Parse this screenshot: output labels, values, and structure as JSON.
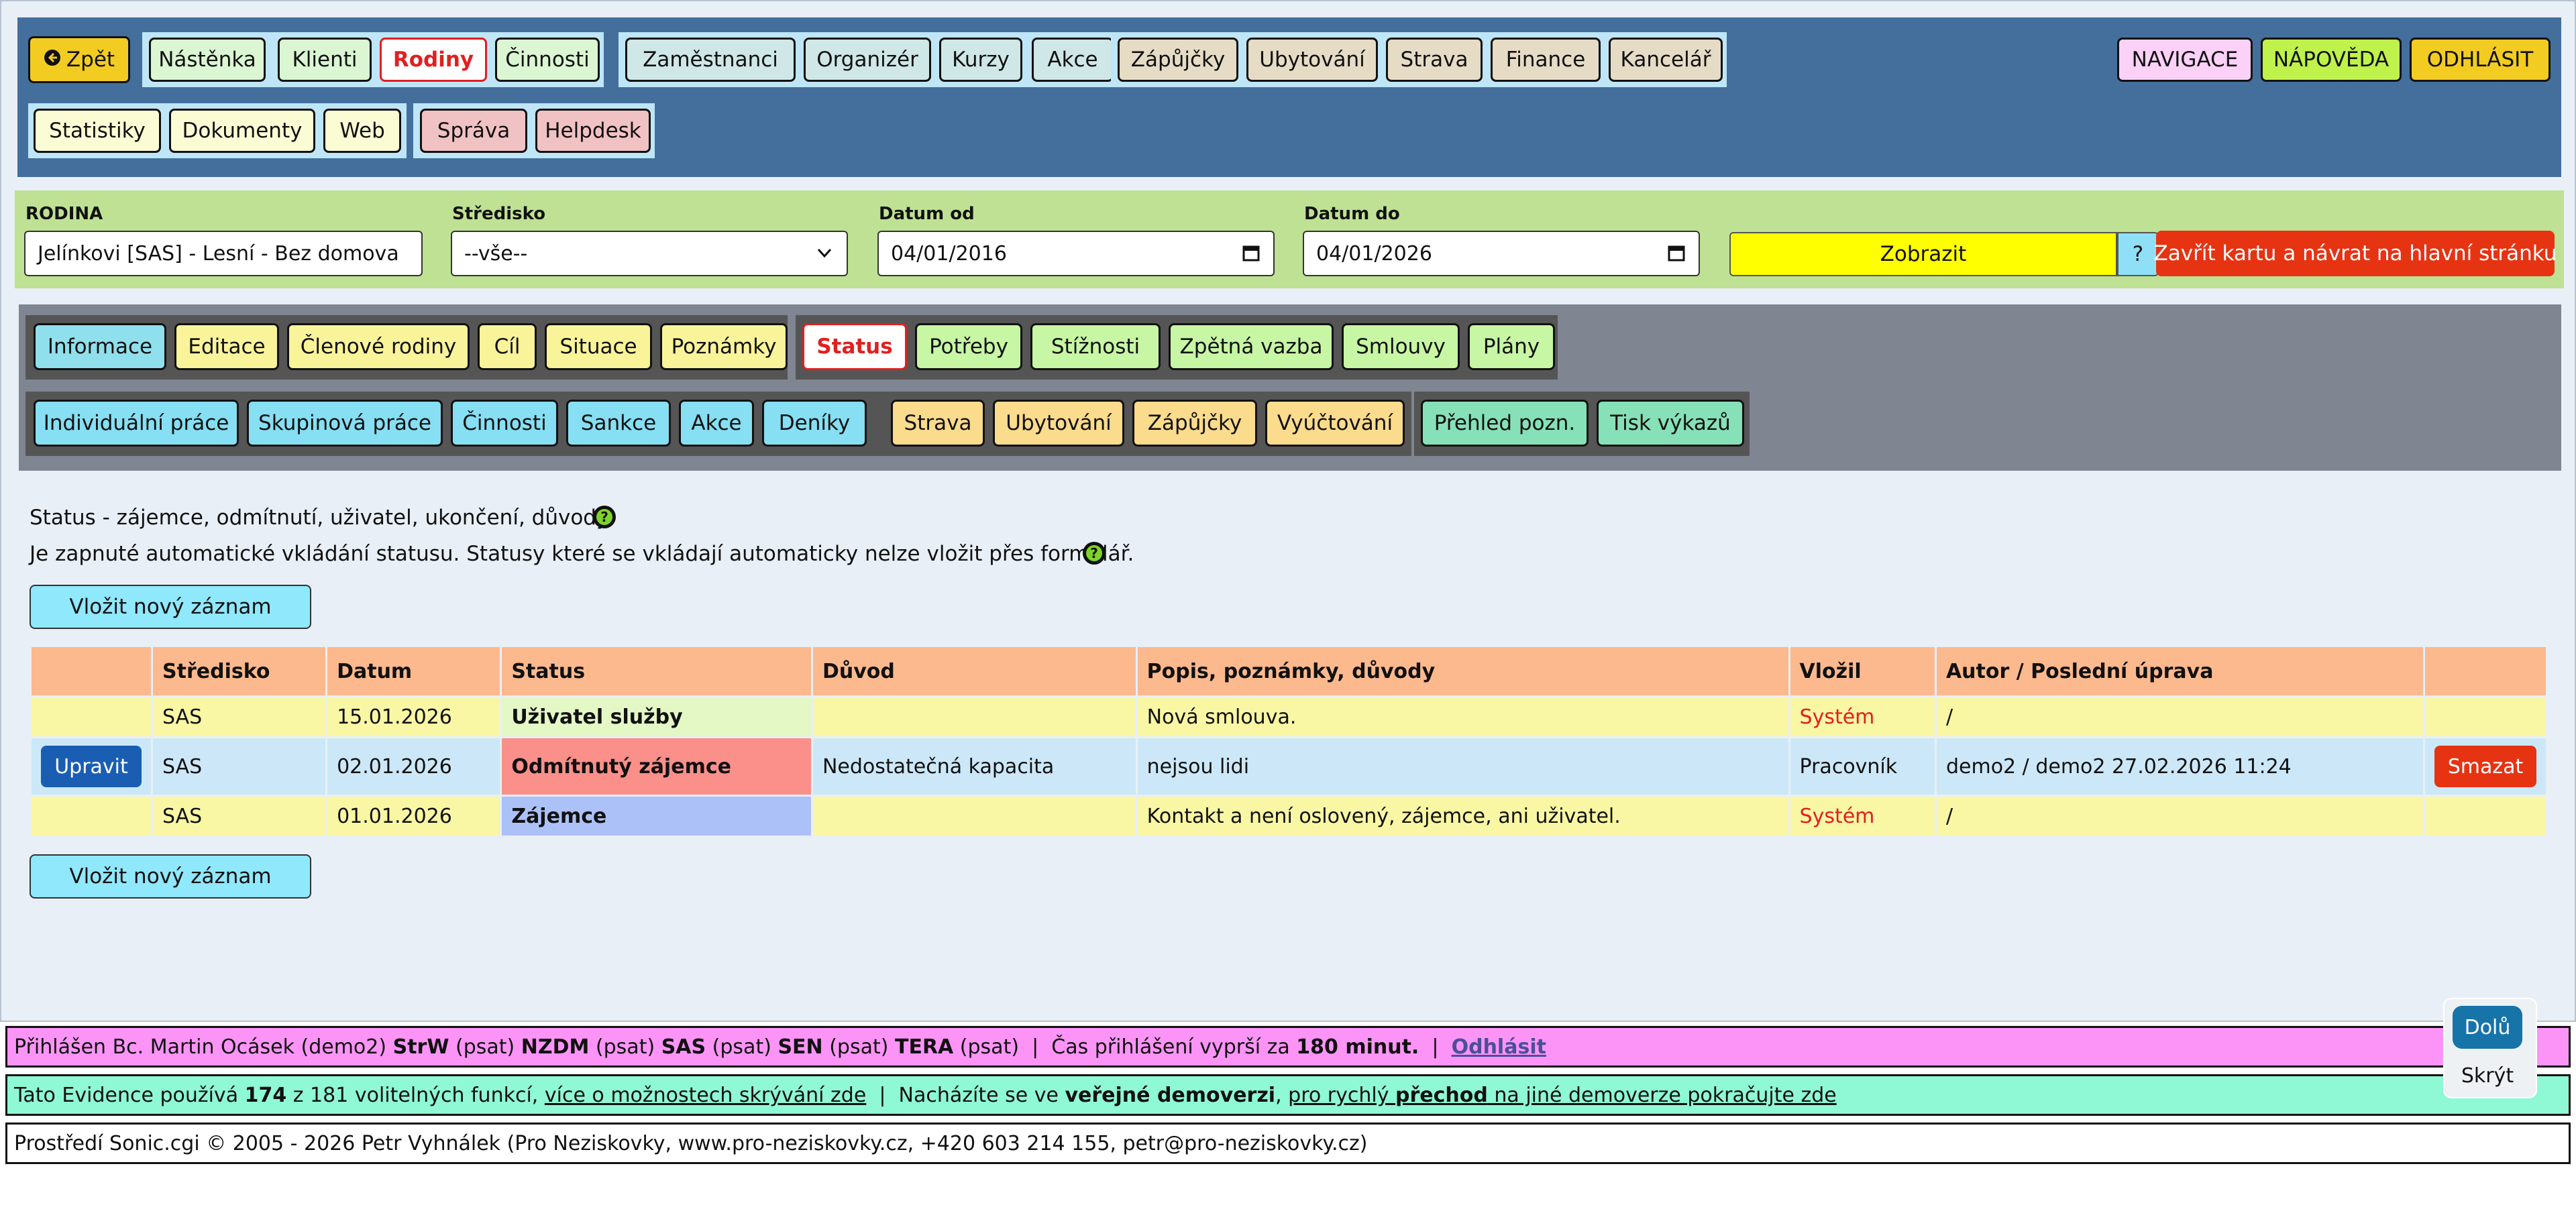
{
  "topnav": {
    "back": "Zpět",
    "group1": [
      "Nástěnka",
      "Klienti",
      "Rodiny",
      "Činnosti"
    ],
    "group2": [
      "Zaměstnanci",
      "Organizér",
      "Kurzy",
      "Akce"
    ],
    "group3": [
      "Zápůjčky",
      "Ubytování",
      "Strava",
      "Finance",
      "Kancelář"
    ],
    "group4": [
      "Statistiky",
      "Dokumenty",
      "Web"
    ],
    "group5": [
      "Správa",
      "Helpdesk"
    ],
    "right": [
      "NAVIGACE",
      "NÁPOVĚDA",
      "ODHLÁSIT"
    ]
  },
  "filter": {
    "rodina_label": "RODINA",
    "rodina_value": "Jelínkovi [SAS] - Lesní - Bez domova",
    "stredisko_label": "Středisko",
    "stredisko_value": "--vše--",
    "datum_od_label": "Datum od",
    "datum_od_value": "04/01/2016",
    "datum_do_label": "Datum do",
    "datum_do_value": "04/01/2026",
    "show_button": "Zobrazit",
    "help_button": "?",
    "close_button": "Zavřít kartu a návrat na hlavní stránku"
  },
  "tabs": {
    "row1_group1": [
      "Informace",
      "Editace",
      "Členové rodiny",
      "Cíl",
      "Situace",
      "Poznámky"
    ],
    "row1_group2": [
      "Status",
      "Potřeby",
      "Stížnosti",
      "Zpětná vazba",
      "Smlouvy",
      "Plány"
    ],
    "row2_group1": [
      "Individuální práce",
      "Skupinová práce",
      "Činnosti",
      "Sankce",
      "Akce",
      "Deníky"
    ],
    "row2_group2": [
      "Strava",
      "Ubytování",
      "Zápůjčky",
      "Vyúčtování"
    ],
    "row2_group3": [
      "Přehled pozn.",
      "Tisk výkazů"
    ]
  },
  "content": {
    "line1": "Status - zájemce, odmítnutí, uživatel, ukončení, důvody.",
    "line2": "Je zapnuté automatické vkládání statusu. Statusy které se vkládají automaticky nelze vložit přes formulář.",
    "insert_button": "Vložit nový záznam"
  },
  "table": {
    "headers": [
      "",
      "Středisko",
      "Datum",
      "Status",
      "Důvod",
      "Popis, poznámky, důvody",
      "Vložil",
      "Autor / Poslední úprava",
      ""
    ],
    "rows": [
      {
        "stredisko": "SAS",
        "datum": "15.01.2026",
        "status": "Uživatel služby",
        "duvod": "",
        "popis": "Nová smlouva.",
        "vlozil": "Systém",
        "autor": "/"
      },
      {
        "edit": "Upravit",
        "stredisko": "SAS",
        "datum": "02.01.2026",
        "status": "Odmítnutý zájemce",
        "duvod": "Nedostatečná kapacita",
        "popis": "nejsou lidi",
        "vlozil": "Pracovník",
        "autor": "demo2 / demo2 27.02.2026 11:24",
        "delete": "Smazat"
      },
      {
        "stredisko": "SAS",
        "datum": "01.01.2026",
        "status": "Zájemce",
        "duvod": "",
        "popis": "Kontakt a není oslovený, zájemce, ani uživatel.",
        "vlozil": "Systém",
        "autor": "/"
      }
    ]
  },
  "footer": {
    "login_prefix": "Přihlášen Bc. Martin Ocásek (demo2) ",
    "roles": [
      {
        "code": "StrW",
        "note": " (psat) "
      },
      {
        "code": "NZDM",
        "note": " (psat) "
      },
      {
        "code": "SAS",
        "note": " (psat) "
      },
      {
        "code": "SEN",
        "note": " (psat) "
      },
      {
        "code": "TERA",
        "note": " (psat)"
      }
    ],
    "sep": "  |  ",
    "expire_prefix": "Čas přihlášení vyprší za ",
    "expire_value": "180 minut.",
    "logout_link": "Odhlásit",
    "usage_prefix": "Tato Evidence používá ",
    "usage_count": "174",
    "usage_mid": " z 181 volitelných funkcí, ",
    "usage_link": "více o možnostech skrývání zde",
    "demo_prefix": "Nacházíte se ve ",
    "demo_bold": "veřejné demoverzi",
    "demo_link_pre": "pro rychlý ",
    "demo_link_bold": "přechod",
    "demo_link_post": " na jiné demoverze pokračujte zde",
    "copy_prefix": "Prostředí ",
    "copy_app": "Sonic.cgi",
    "copy_mid": " © 2005 - 2026 Petr Vyhnálek (Pro Neziskovky, ",
    "copy_web": "www.pro-neziskovky.cz",
    "copy_phone": ", +420 603 214 155, ",
    "copy_email": "petr@pro-neziskovky.cz",
    "copy_end": ")"
  },
  "scroll": {
    "down": "Dolů",
    "hide": "Skrýt"
  }
}
